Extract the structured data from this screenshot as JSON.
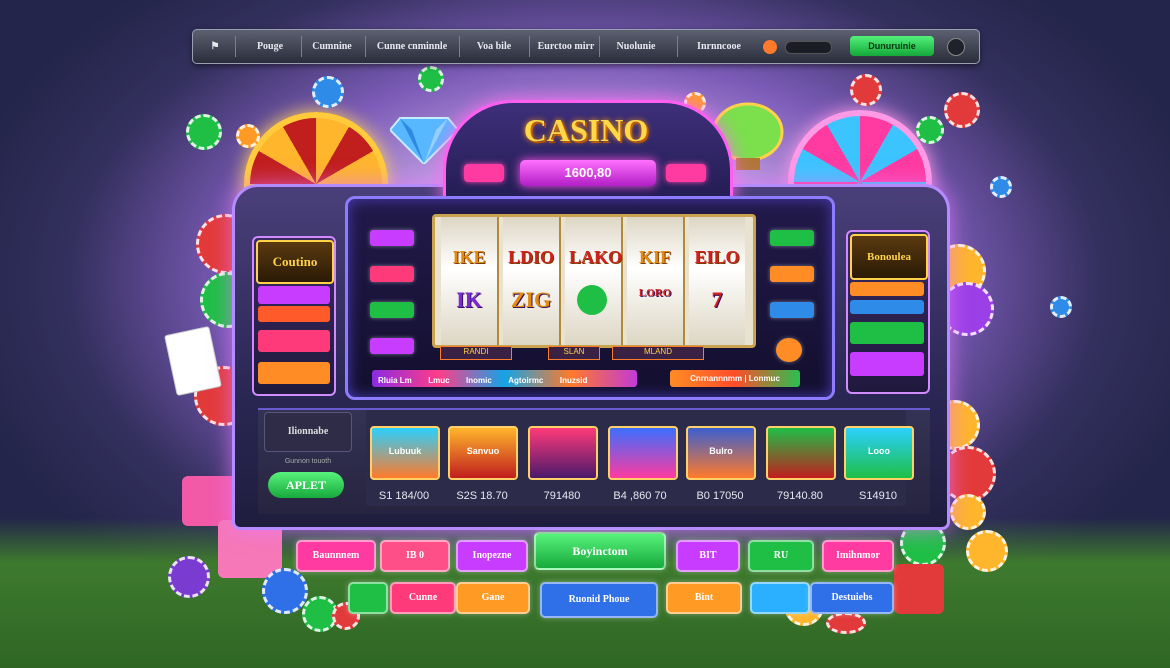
{
  "nav": {
    "items": [
      "Pouge",
      "Cumnine",
      "Cunne cnminnle",
      "Voa bile",
      "Eurctoo mirr",
      "Nuolunie",
      "Inrnncooe"
    ],
    "cta": "Dunuruinie"
  },
  "logo": "CASINO",
  "jackpot": "1600,80",
  "reels": [
    {
      "top": "IKE",
      "bottom": "IK"
    },
    {
      "top": "LDIO",
      "bottom": "ZIG"
    },
    {
      "top": "LAKO",
      "bottom": ""
    },
    {
      "top": "KIF",
      "bottom": "LORO"
    },
    {
      "top": "EILO",
      "bottom": "7"
    }
  ],
  "reel_footer": [
    "RANDI",
    "SLAN",
    "MLAND"
  ],
  "strip_labels": [
    "Rluia Lm",
    "Lmuc",
    "Inomic",
    "Agtoirmc",
    "Inuzsid"
  ],
  "strip2": "Cnrnannnmm | Lonmuc",
  "left_logo": "Coutino",
  "right_logo": "Bonoulea",
  "promo": {
    "title": "Ilionnabe",
    "subtitle": "Gunnon touoth",
    "apply": "APLET"
  },
  "games": [
    "Lubuuk",
    "Sanvuo",
    "",
    "",
    "Bulro",
    "",
    "Looo"
  ],
  "prices": [
    "S1 184/00",
    "S2S 18.70",
    "791480",
    "B4 ,860 70",
    "B0 17050",
    "79140.80",
    "S14910"
  ],
  "buttons_row1": [
    "Baunnnem",
    "IB 0",
    "Inopezne",
    "Boyinctom",
    "BIT",
    "RU",
    "Imihnmor"
  ],
  "buttons_row2": [
    "",
    "Cunne",
    "Gane",
    "Ruonid Phoue",
    "Bint",
    "",
    "Destuiebs"
  ],
  "colors": {
    "accent_pink": "#ff3aa0",
    "accent_green": "#1fbf46",
    "accent_purple": "#9b3fe6",
    "accent_blue": "#2f6fe8",
    "accent_orange": "#ff9b25"
  }
}
